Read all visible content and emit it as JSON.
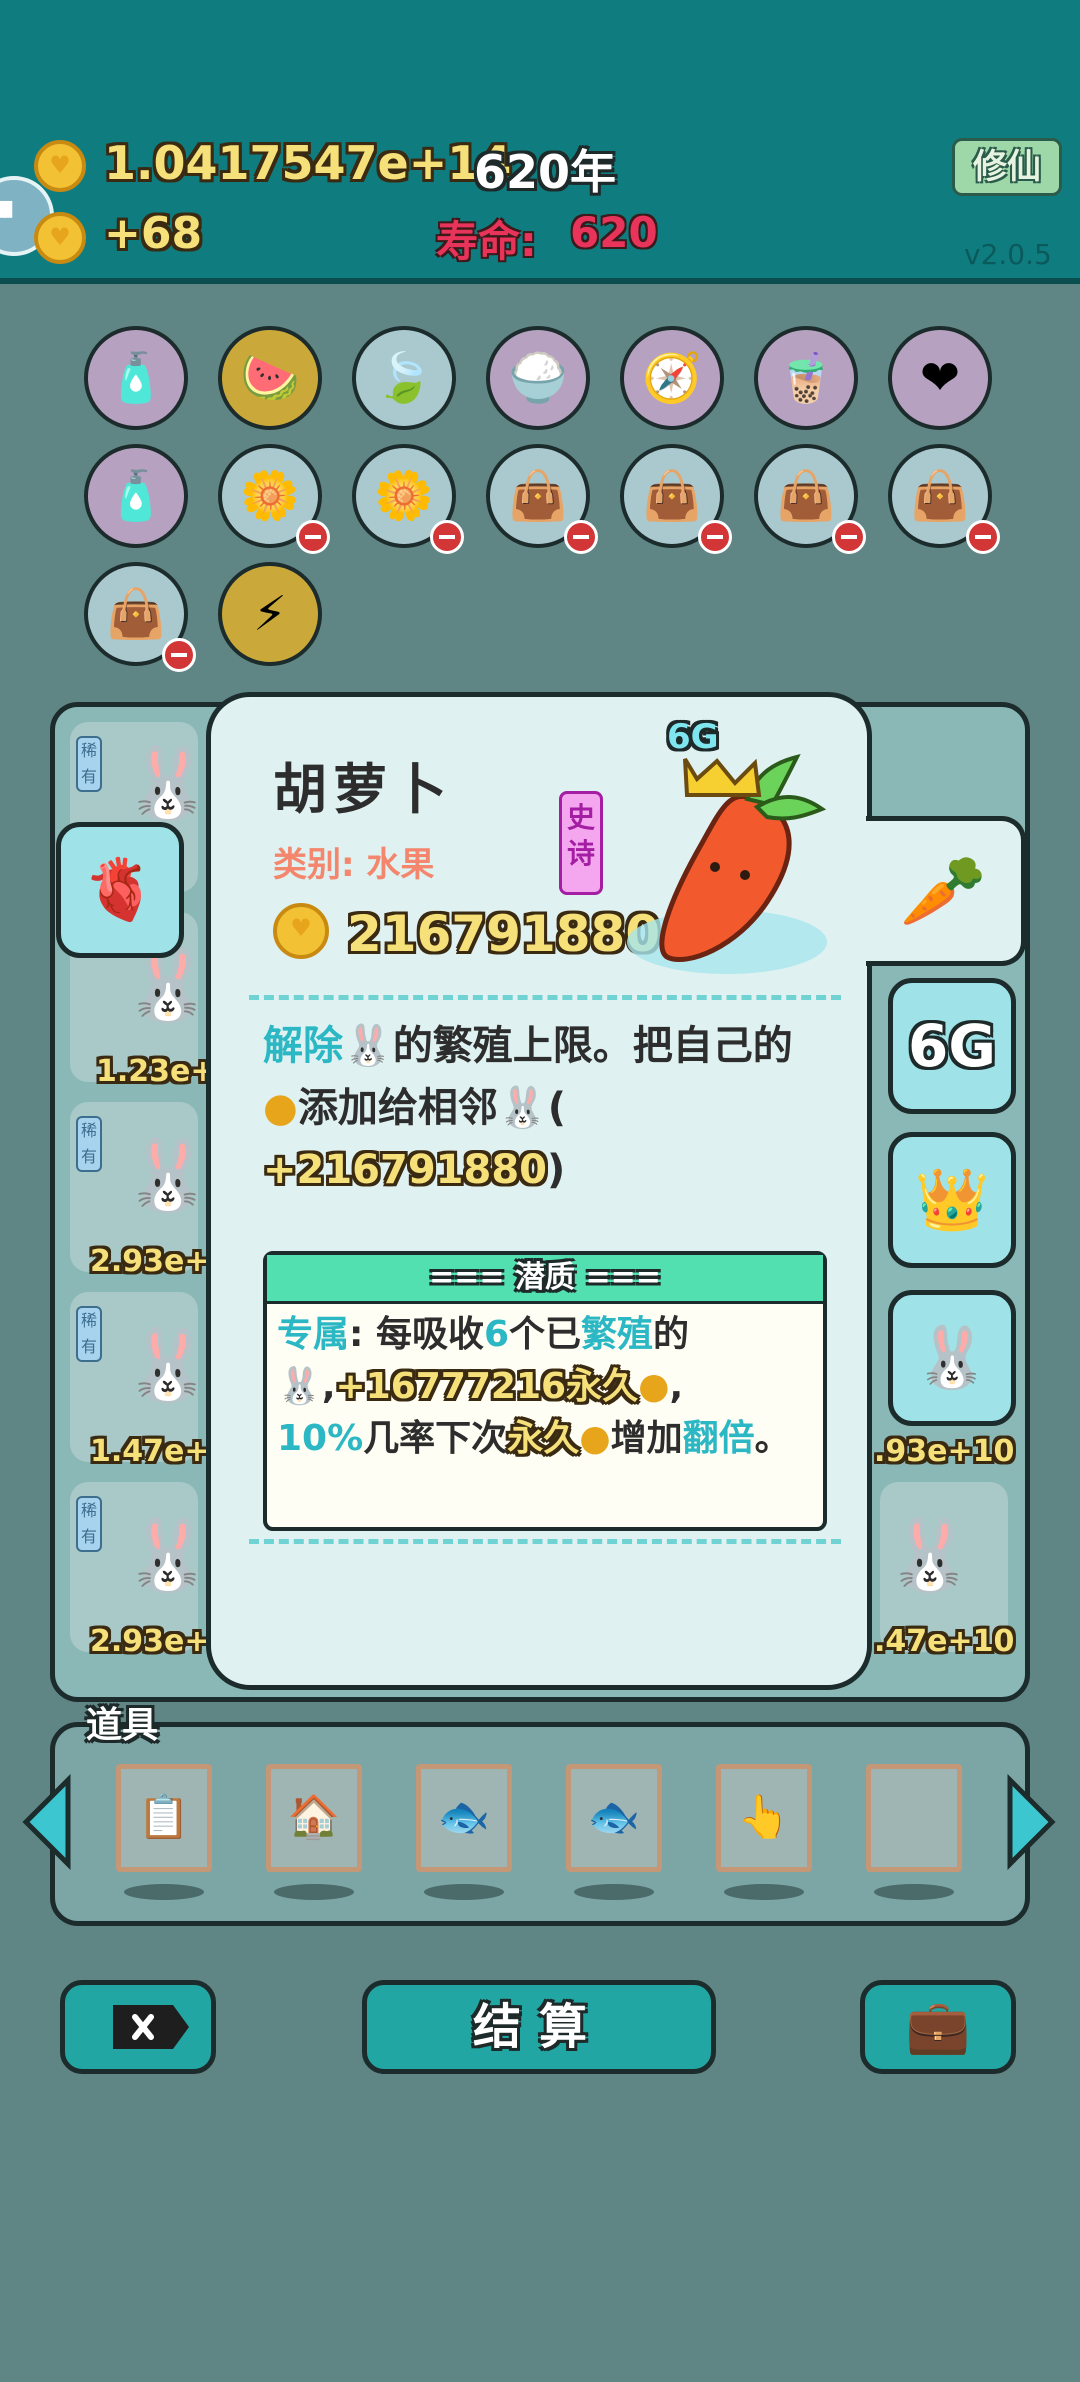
{
  "top": {
    "coins": "1.0417547e+14",
    "year": "620年",
    "income": "+68",
    "lifespan_label": "寿命:",
    "lifespan_value": "620",
    "cultivate_button": "修仙",
    "version": "v2.0.5"
  },
  "items": {
    "row1": [
      "spray-bottle-icon",
      "fruit-basket-icon",
      "leaf-icon",
      "rice-bowl-icon",
      "compass-icon",
      "bubble-tea-icon",
      "blood-bag-icon"
    ],
    "row2": [
      "spray-bottle-icon",
      "flower-pot-icon",
      "flower-pot-icon",
      "sack-icon",
      "sack-icon",
      "sack-icon",
      "sack-icon"
    ],
    "row3": [
      "sack-icon",
      "lightning-icon"
    ]
  },
  "board": {
    "tag": "稀有",
    "left_values": [
      "1.23e+",
      "2.93e+",
      "1.47e+",
      "2.93e+"
    ],
    "right_values": [
      ".93e+10",
      ".47e+10"
    ]
  },
  "card": {
    "title": "胡萝卜",
    "category": "类别: 水果",
    "rarity": "史诗",
    "value": "216791880",
    "art_badge": "6G",
    "desc_1": "解除",
    "desc_2": "的繁殖上限。把自己的",
    "desc_3": "添加给相邻",
    "desc_4": "(",
    "desc_bonus": "+216791880",
    "desc_5": ")",
    "potential_header": "=== 潜质 ===",
    "pot_1a": "专属",
    "pot_1b": ": 每吸收",
    "pot_1c": "6",
    "pot_1d": "个已",
    "pot_1e": "繁殖",
    "pot_1f": "的",
    "pot_2a": ",",
    "pot_2b": "+16777216永久",
    "pot_2c": ",",
    "pot_3a": "10%",
    "pot_3b": "几率下次",
    "pot_3c": "永久",
    "pot_3d": "增加",
    "pot_3e": "翻倍",
    "pot_3f": "。"
  },
  "side_tabs": {
    "badge_6g": "6G"
  },
  "props": {
    "label": "道具",
    "slots": [
      "copy-paste-icon",
      "windmill-icon",
      "fish-icon",
      "fish-icon",
      "pointer-hand-icon",
      "empty-slot"
    ]
  },
  "buttons": {
    "settle": "结算"
  },
  "colors": {
    "topbar": "#0f7d80",
    "accent": "#21a6a3",
    "coin": "#f2c234",
    "rarity_epic": "#a41ea4"
  }
}
